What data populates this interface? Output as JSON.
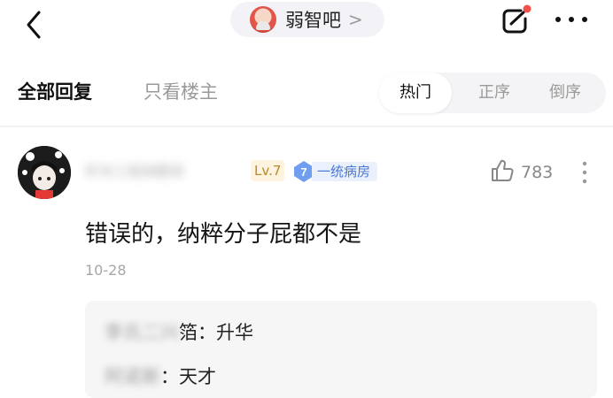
{
  "topbar": {
    "forum_name": "弱智吧",
    "forum_arrow": ">",
    "notification_color": "#f4504b"
  },
  "tabs": {
    "all_replies": "全部回复",
    "op_only": "只看楼主",
    "sort": [
      {
        "label": "热门",
        "active": true
      },
      {
        "label": "正序",
        "active": false
      },
      {
        "label": "倒序",
        "active": false
      }
    ]
  },
  "post": {
    "username": "虾米三姐妹翻滚",
    "level": "Lv.7",
    "title_badge_level": "7",
    "title_badge_text": "一统病房",
    "likes": "783",
    "content": "错误的，纳粹分子屁都不是",
    "date": "10-28",
    "sub_replies": [
      {
        "name": "李氏二兴",
        "name_suffix": "箔",
        "text": "：升华"
      },
      {
        "name": "阿诺斯",
        "name_suffix": "",
        "text": "：天才"
      }
    ]
  },
  "colors": {
    "badge_blue": "#4a78d6",
    "level_gold": "#b58b2e"
  },
  "icons": [
    "back-arrow-icon",
    "edit-icon",
    "more-dots-icon",
    "thumbs-up-icon",
    "vertical-dots-icon",
    "diamond-badge-icon"
  ]
}
